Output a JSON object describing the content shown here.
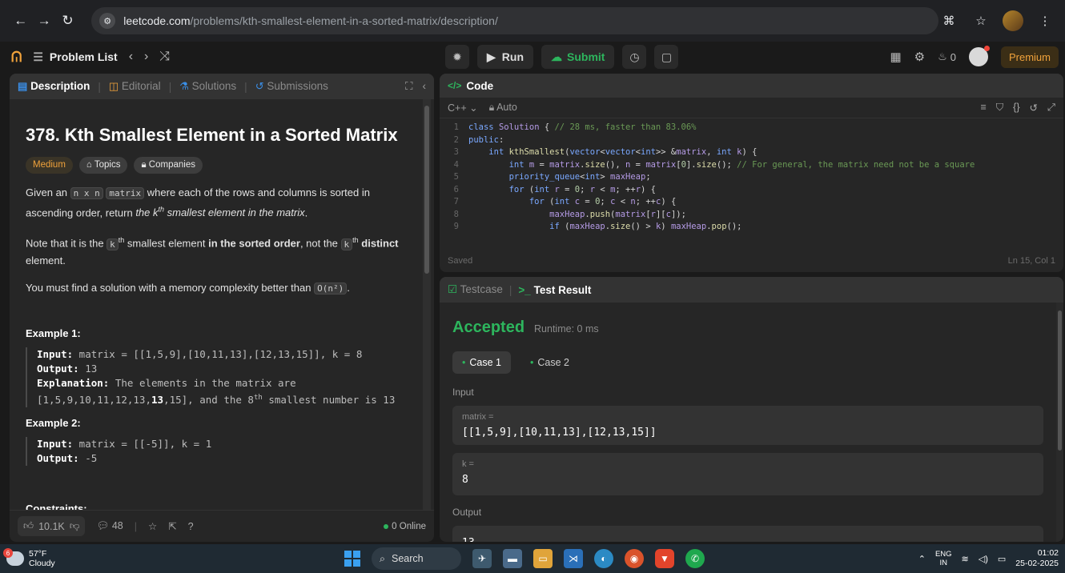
{
  "browser": {
    "url_domain": "leetcode.com",
    "url_path": "/problems/kth-smallest-element-in-a-sorted-matrix/description/"
  },
  "topbar": {
    "problem_list_label": "Problem List",
    "run_label": "Run",
    "submit_label": "Submit",
    "streak_count": "0",
    "premium_label": "Premium"
  },
  "left_tabs": {
    "description": "Description",
    "editorial": "Editorial",
    "solutions": "Solutions",
    "submissions": "Submissions"
  },
  "problem": {
    "title": "378. Kth Smallest Element in a Sorted Matrix",
    "difficulty": "Medium",
    "topics_label": "Topics",
    "companies_label": "Companies",
    "p1_a": "Given an ",
    "p1_code_n": "n x n",
    "p1_code_matrix": "matrix",
    "p1_b": " where each of the rows and columns is sorted in ascending order, return ",
    "p1_c": "the k",
    "p1_sup": "th",
    "p1_d": " smallest element in the matrix",
    "p1_e": ".",
    "p2_a": "Note that it is the ",
    "p2_code_k": "k",
    "p2_sup": "th",
    "p2_b": " smallest element ",
    "p2_bold": "in the sorted order",
    "p2_c": ", not the ",
    "p2_code_k2": "k",
    "p2_sup2": "th",
    "p2_bold2": " distinct",
    "p2_d": " element.",
    "p3_a": "You must find a solution with a memory complexity better than ",
    "p3_code": "O(n²)",
    "p3_b": ".",
    "example1_heading": "Example 1:",
    "example1_input_label": "Input:",
    "example1_input": " matrix = [[1,5,9],[10,11,13],[12,13,15]], k = 8",
    "example1_output_label": "Output:",
    "example1_output": " 13",
    "example1_expl_label": "Explanation:",
    "example1_expl_1": " The elements in the matrix are",
    "example1_expl_2a": "[1,5,9,10,11,12,13,",
    "example1_expl_2b": "13",
    "example1_expl_2c": ",15], and the 8",
    "example1_expl_sup": "th",
    "example1_expl_2d": " smallest number is 13",
    "example2_heading": "Example 2:",
    "example2_input_label": "Input:",
    "example2_input": " matrix = [[-5]], k = 1",
    "example2_output_label": "Output:",
    "example2_output": " -5",
    "constraints_heading": "Constraints:"
  },
  "left_footer": {
    "likes": "10.1K",
    "comments": "48",
    "online": "0 Online"
  },
  "code": {
    "header": "Code",
    "language": "C++",
    "mode": "Auto",
    "status": "Saved",
    "cursor": "Ln 15, Col 1",
    "lines": [
      {
        "n": "1",
        "t": "class Solution { // 28 ms, faster than 83.06%"
      },
      {
        "n": "2",
        "t": "public:"
      },
      {
        "n": "3",
        "t": "    int kthSmallest(vector<vector<int>> &matrix, int k) {"
      },
      {
        "n": "4",
        "t": "        int m = matrix.size(), n = matrix[0].size(); // For general, the matrix need not be a square"
      },
      {
        "n": "5",
        "t": "        priority_queue<int> maxHeap;"
      },
      {
        "n": "6",
        "t": "        for (int r = 0; r < m; ++r) {"
      },
      {
        "n": "7",
        "t": "            for (int c = 0; c < n; ++c) {"
      },
      {
        "n": "8",
        "t": "                maxHeap.push(matrix[r][c]);"
      },
      {
        "n": "9",
        "t": "                if (maxHeap.size() > k) maxHeap.pop();"
      }
    ]
  },
  "result": {
    "testcase_tab": "Testcase",
    "result_tab": "Test Result",
    "verdict": "Accepted",
    "runtime": "Runtime: 0 ms",
    "case1": "Case 1",
    "case2": "Case 2",
    "input_label": "Input",
    "var1_name": "matrix =",
    "var1_value": "[[1,5,9],[10,11,13],[12,13,15]]",
    "var2_name": "k =",
    "var2_value": "8",
    "output_label": "Output",
    "output_value": "13"
  },
  "taskbar": {
    "temperature": "57°F",
    "condition": "Cloudy",
    "notification_count": "6",
    "search_label": "Search",
    "lang_1": "ENG",
    "lang_2": "IN",
    "time": "01:02",
    "date": "25-02-2025"
  },
  "colors": {
    "accent_green": "#2db55d",
    "medium_orange": "#f0a23b",
    "background": "#1a1a1a",
    "panel": "#262626"
  }
}
